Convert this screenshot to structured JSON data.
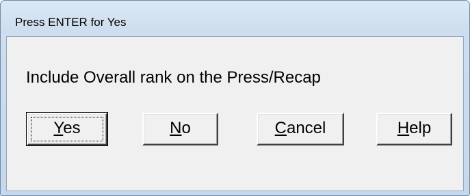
{
  "dialog": {
    "title": "Press ENTER for Yes",
    "message": "Include Overall rank on the Press/Recap"
  },
  "buttons": [
    {
      "mnemonic": "Y",
      "rest": "es"
    },
    {
      "mnemonic": "N",
      "rest": "o"
    },
    {
      "mnemonic": "C",
      "rest": "ancel"
    },
    {
      "mnemonic": "H",
      "rest": "elp"
    }
  ]
}
